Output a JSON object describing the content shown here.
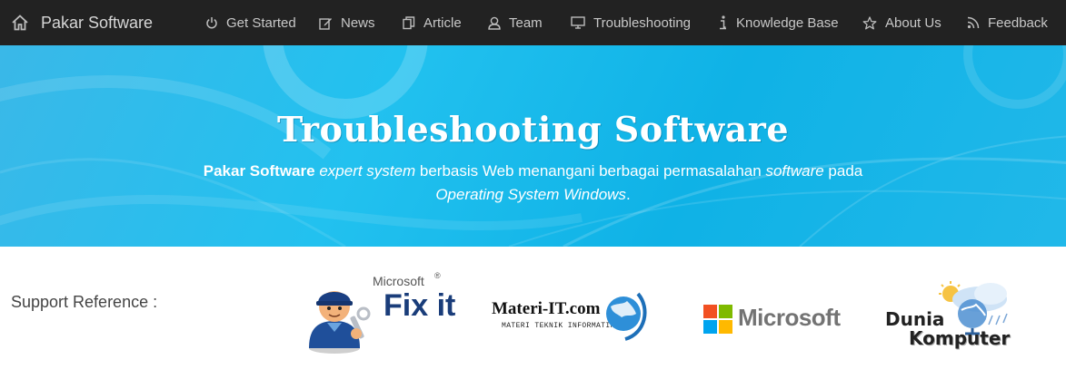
{
  "navbar": {
    "brand": {
      "label": "Pakar Software",
      "icon": "home-icon"
    },
    "items": [
      {
        "label": "Get Started",
        "icon": "power-icon"
      },
      {
        "label": "News",
        "icon": "edit-icon"
      },
      {
        "label": "Article",
        "icon": "copy-icon"
      },
      {
        "label": "Team",
        "icon": "user-icon"
      },
      {
        "label": "Troubleshooting",
        "icon": "monitor-icon"
      },
      {
        "label": "Knowledge Base",
        "icon": "info-icon"
      },
      {
        "label": "About Us",
        "icon": "star-icon"
      },
      {
        "label": "Feedback",
        "icon": "feed-icon"
      }
    ]
  },
  "hero": {
    "title": "Troubleshooting Software",
    "subtitle": {
      "brand": "Pakar Software",
      "term": "expert system",
      "text1": "berbasis Web menangani berbagai permasalahan",
      "software": "software",
      "text2": "pada",
      "os": "Operating System Windows",
      "end": "."
    }
  },
  "support": {
    "label": "Support Reference :",
    "logos": [
      {
        "name": "Microsoft Fix it",
        "line1": "Microsoft",
        "line2": "Fix it",
        "reg": "®"
      },
      {
        "name": "Materi-IT.com",
        "line1": "Materi-IT.com",
        "line2": "MATERI TEKNIK INFORMATIKA"
      },
      {
        "name": "Microsoft",
        "line1": "Microsoft"
      },
      {
        "name": "Dunia Komputer",
        "line1": "Dunia",
        "line2": "Komputer"
      }
    ]
  },
  "colors": {
    "navbar_bg": "#222222",
    "hero_blue": "#1fbcec",
    "ms_red": "#f25022",
    "ms_green": "#7fba00",
    "ms_blue": "#00a4ef",
    "ms_yellow": "#ffb900"
  }
}
